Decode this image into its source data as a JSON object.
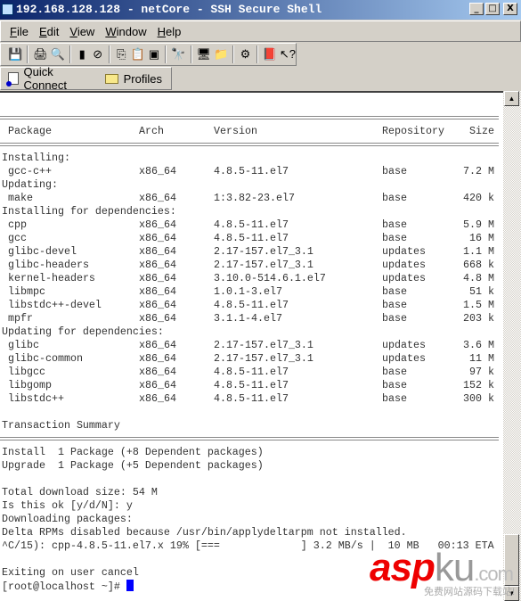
{
  "window": {
    "title": "192.168.128.128 - netCore - SSH Secure Shell",
    "min": "_",
    "max": "□",
    "close": "X"
  },
  "menu": [
    {
      "u": "F",
      "rest": "ile"
    },
    {
      "u": "E",
      "rest": "dit"
    },
    {
      "u": "V",
      "rest": "iew"
    },
    {
      "u": "W",
      "rest": "indow"
    },
    {
      "u": "H",
      "rest": "elp"
    }
  ],
  "toolbar": [
    {
      "icon": "save-icon",
      "glyph": "💾"
    },
    {
      "sep": true
    },
    {
      "icon": "print-icon",
      "glyph": "🖨"
    },
    {
      "icon": "print-preview-icon",
      "glyph": "🔍"
    },
    {
      "sep": true
    },
    {
      "icon": "connect-icon",
      "glyph": "▮"
    },
    {
      "icon": "disconnect-icon",
      "glyph": "⊘"
    },
    {
      "sep": true
    },
    {
      "icon": "copy-icon",
      "glyph": "⎘"
    },
    {
      "icon": "paste-icon",
      "glyph": "📋"
    },
    {
      "icon": "paste-disabled-icon",
      "glyph": "▣"
    },
    {
      "sep": true
    },
    {
      "icon": "find-icon",
      "glyph": "🔭"
    },
    {
      "sep": true
    },
    {
      "icon": "new-terminal-icon",
      "glyph": "🖥"
    },
    {
      "icon": "new-file-transfer-icon",
      "glyph": "📁"
    },
    {
      "sep": true
    },
    {
      "icon": "settings-icon",
      "glyph": "⚙"
    },
    {
      "sep": true
    },
    {
      "icon": "help-book-icon",
      "glyph": "📕"
    },
    {
      "icon": "context-help-icon",
      "glyph": "↖?"
    }
  ],
  "connbar": {
    "quick_connect": "Quick Connect",
    "profiles": "Profiles"
  },
  "terminal": {
    "header": {
      "package": "Package",
      "arch": "Arch",
      "version": "Version",
      "repository": "Repository",
      "size": "Size"
    },
    "groups": [
      {
        "title": "Installing:",
        "rows": [
          [
            "gcc-c++",
            "x86_64",
            "4.8.5-11.el7",
            "base",
            "7.2 M"
          ]
        ]
      },
      {
        "title": "Updating:",
        "rows": [
          [
            "make",
            "x86_64",
            "1:3.82-23.el7",
            "base",
            "420 k"
          ]
        ]
      },
      {
        "title": "Installing for dependencies:",
        "rows": [
          [
            "cpp",
            "x86_64",
            "4.8.5-11.el7",
            "base",
            "5.9 M"
          ],
          [
            "gcc",
            "x86_64",
            "4.8.5-11.el7",
            "base",
            "16 M"
          ],
          [
            "glibc-devel",
            "x86_64",
            "2.17-157.el7_3.1",
            "updates",
            "1.1 M"
          ],
          [
            "glibc-headers",
            "x86_64",
            "2.17-157.el7_3.1",
            "updates",
            "668 k"
          ],
          [
            "kernel-headers",
            "x86_64",
            "3.10.0-514.6.1.el7",
            "updates",
            "4.8 M"
          ],
          [
            "libmpc",
            "x86_64",
            "1.0.1-3.el7",
            "base",
            "51 k"
          ],
          [
            "libstdc++-devel",
            "x86_64",
            "4.8.5-11.el7",
            "base",
            "1.5 M"
          ],
          [
            "mpfr",
            "x86_64",
            "3.1.1-4.el7",
            "base",
            "203 k"
          ]
        ]
      },
      {
        "title": "Updating for dependencies:",
        "rows": [
          [
            "glibc",
            "x86_64",
            "2.17-157.el7_3.1",
            "updates",
            "3.6 M"
          ],
          [
            "glibc-common",
            "x86_64",
            "2.17-157.el7_3.1",
            "updates",
            "11 M"
          ],
          [
            "libgcc",
            "x86_64",
            "4.8.5-11.el7",
            "base",
            "97 k"
          ],
          [
            "libgomp",
            "x86_64",
            "4.8.5-11.el7",
            "base",
            "152 k"
          ],
          [
            "libstdc++",
            "x86_64",
            "4.8.5-11.el7",
            "base",
            "300 k"
          ]
        ]
      }
    ],
    "summary_title": "Transaction Summary",
    "summary": [
      "Install  1 Package (+8 Dependent packages)",
      "Upgrade  1 Package (+5 Dependent packages)"
    ],
    "tail": [
      "",
      "Total download size: 54 M",
      "Is this ok [y/d/N]: y",
      "Downloading packages:",
      "Delta RPMs disabled because /usr/bin/applydeltarpm not installed.",
      "^C/15): cpp-4.8.5-11.el7.x 19% [===             ] 3.2 MB/s |  10 MB   00:13 ETA",
      "",
      "Exiting on user cancel"
    ],
    "prompt": "[root@localhost ~]# "
  },
  "watermark": {
    "brand": "asp",
    "brand2": "ku",
    "suffix": ".com",
    "tagline": "免费网站源码下载站!"
  }
}
